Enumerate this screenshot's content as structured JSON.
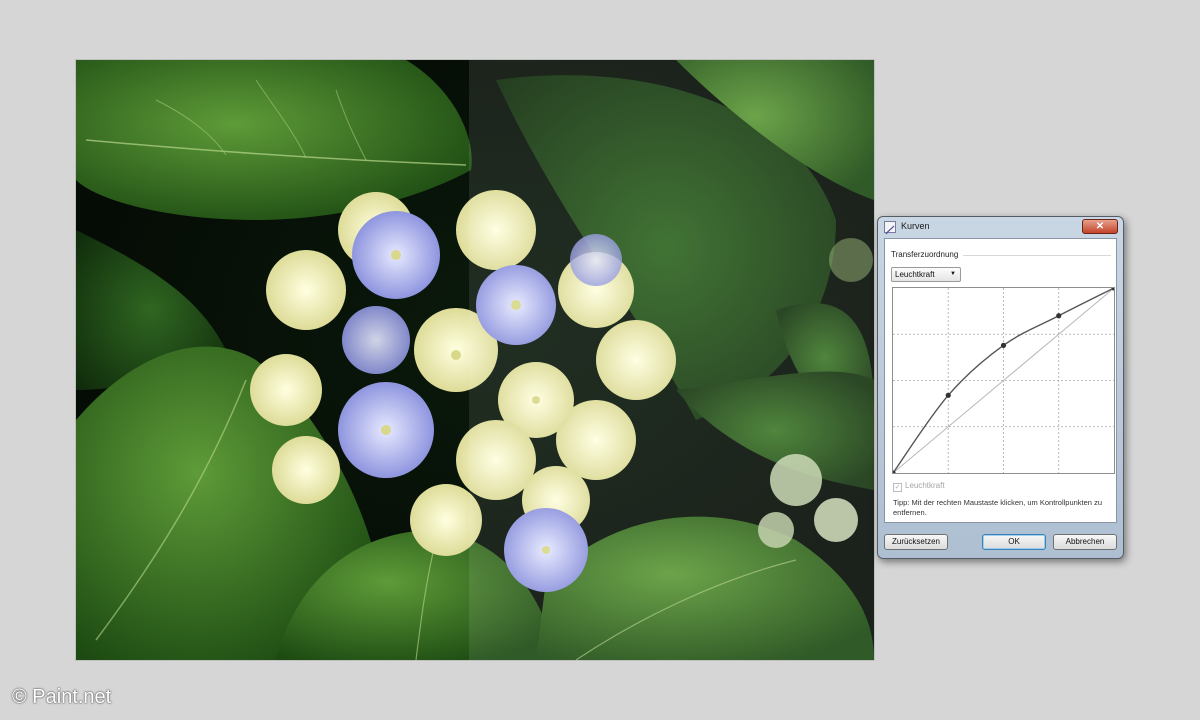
{
  "dialog": {
    "title": "Kurven",
    "close_label": "✕",
    "section_label": "Transferzuordnung",
    "mode_select": {
      "value": "Leuchtkraft"
    },
    "checkbox": {
      "label": "Leuchtkraft",
      "checked": true
    },
    "tip": "Tipp: Mit der rechten Maustaste klicken, um Kontrollpunkten zu entfernen.",
    "buttons": {
      "reset": "Zurücksetzen",
      "ok": "OK",
      "cancel": "Abbrechen"
    },
    "curve": {
      "control_points": [
        [
          0,
          0
        ],
        [
          0.25,
          0.42
        ],
        [
          0.5,
          0.69
        ],
        [
          0.75,
          0.85
        ],
        [
          1,
          1
        ]
      ]
    }
  },
  "watermark": "© Paint.net",
  "colors": {
    "background": "#d6d6d6",
    "leaf_green": "#2f6b1e",
    "flower_blue": "#8a90e0",
    "flower_cream": "#f2f0b8",
    "dialog_frame": "#b8c8da",
    "close_red": "#c2432a"
  }
}
